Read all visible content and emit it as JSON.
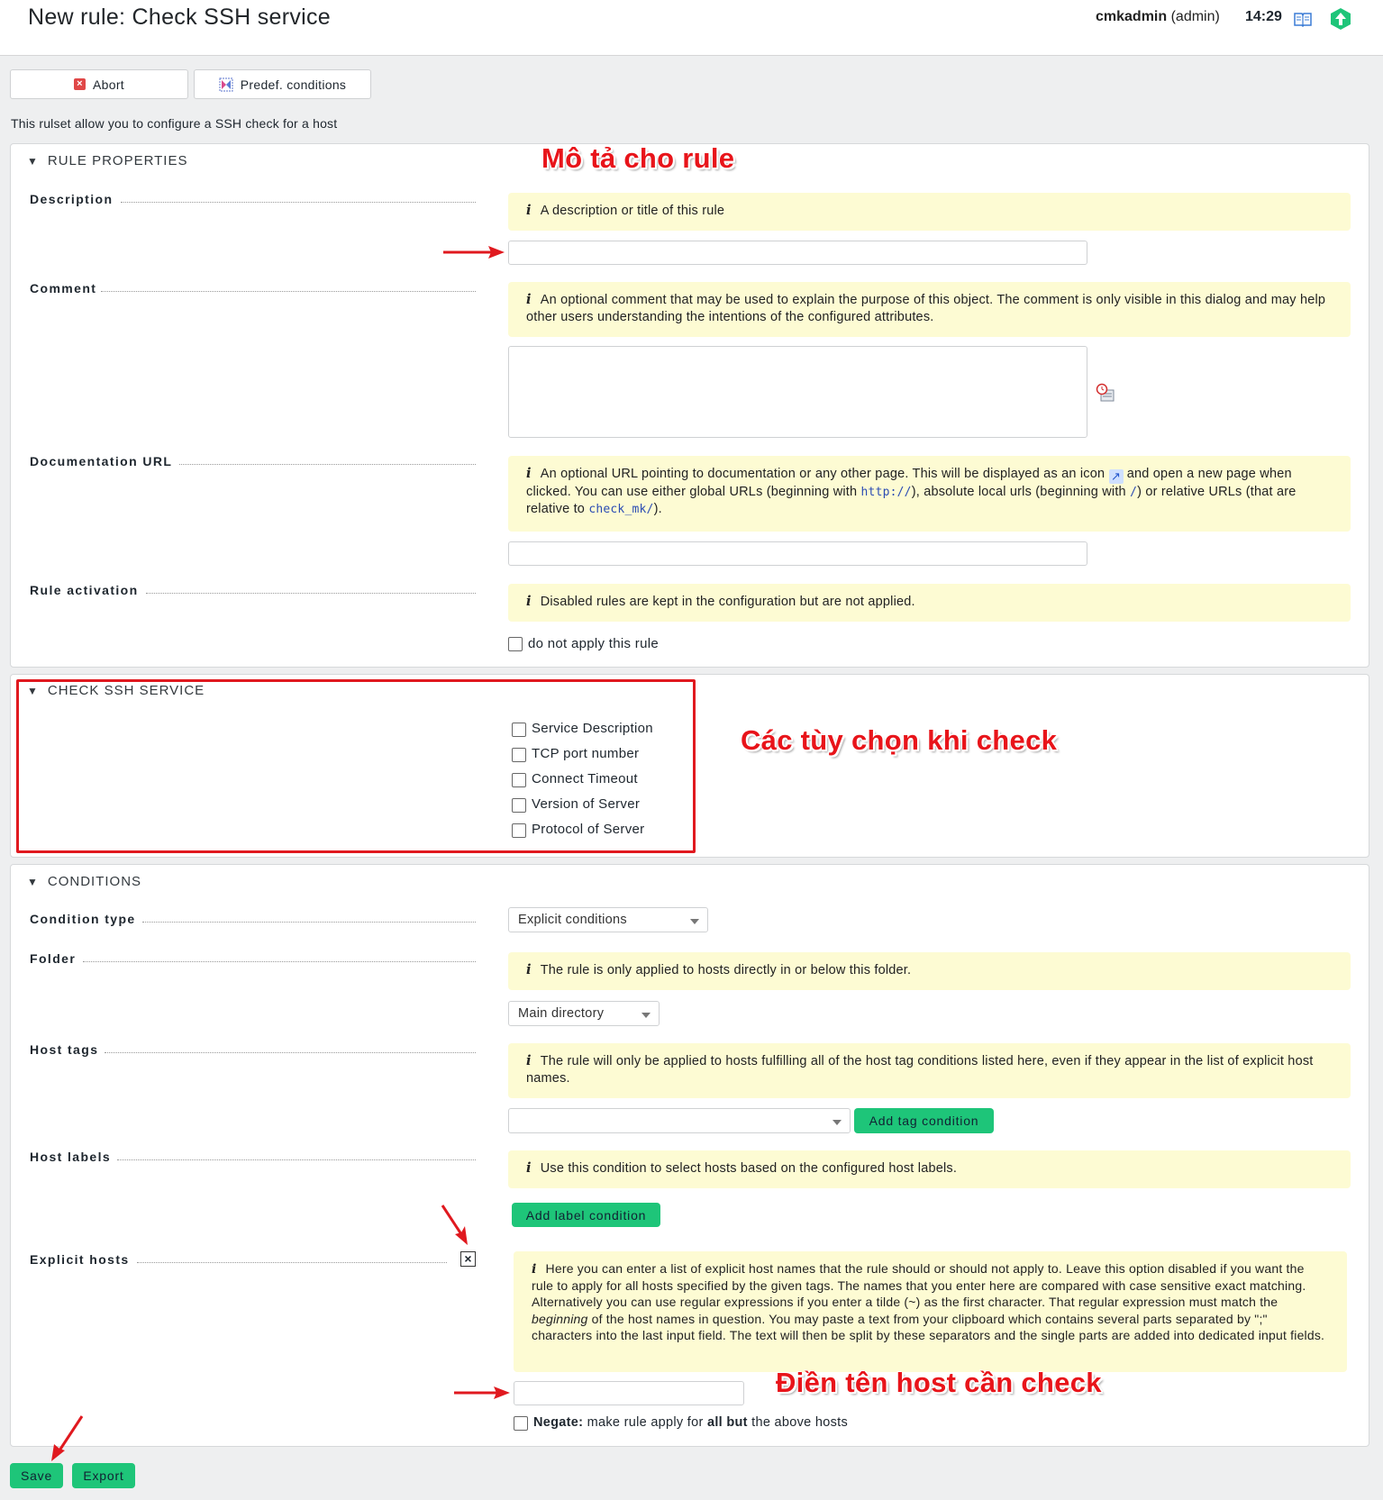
{
  "header": {
    "title": "New rule: Check SSH service",
    "user": "cmkadmin",
    "role": "(admin)",
    "time": "14:29"
  },
  "toolbar": {
    "abort_label": "Abort",
    "predef_label": "Predef. conditions"
  },
  "intro_text": "This rulset allow you to configure a SSH check for a host",
  "rule_properties": {
    "heading": "RULE PROPERTIES",
    "description": {
      "label": "Description",
      "help": "A description or title of this rule",
      "value": ""
    },
    "comment": {
      "label": "Comment",
      "help": "An optional comment that may be used to explain the purpose of this object. The comment is only visible in this dialog and may help other users understanding the intentions of the configured attributes.",
      "value": ""
    },
    "documentation_url": {
      "label": "Documentation URL",
      "help_part1": "An optional URL pointing to documentation or any other page. This will be displayed as an icon",
      "help_part2": "and open a new page when clicked. You can use either global URLs (beginning with",
      "help_code1": "http://",
      "help_part3": "), absolute local urls (beginning with",
      "help_code2": "/",
      "help_part4": ") or relative URLs (that are relative to",
      "help_code3": "check_mk/",
      "help_part5": ").",
      "value": ""
    },
    "rule_activation": {
      "label": "Rule activation",
      "help": "Disabled rules are kept in the configuration but are not applied.",
      "checkbox_label": "do not apply this rule",
      "checked": false
    }
  },
  "check_ssh": {
    "heading": "CHECK SSH SERVICE",
    "options": [
      {
        "label": "Service Description",
        "checked": false
      },
      {
        "label": "TCP port number",
        "checked": false
      },
      {
        "label": "Connect Timeout",
        "checked": false
      },
      {
        "label": "Version of Server",
        "checked": false
      },
      {
        "label": "Protocol of Server",
        "checked": false
      }
    ]
  },
  "conditions": {
    "heading": "CONDITIONS",
    "condition_type": {
      "label": "Condition type",
      "value": "Explicit conditions"
    },
    "folder": {
      "label": "Folder",
      "help": "The rule is only applied to hosts directly in or below this folder.",
      "value": "Main directory"
    },
    "host_tags": {
      "label": "Host tags",
      "help": "The rule will only be applied to hosts fulfilling all of the host tag conditions listed here, even if they appear in the list of explicit host names.",
      "value": "",
      "button": "Add tag condition"
    },
    "host_labels": {
      "label": "Host labels",
      "help": "Use this condition to select hosts based on the configured host labels.",
      "button": "Add label condition"
    },
    "explicit_hosts": {
      "label": "Explicit hosts",
      "checked": true,
      "help_a": "Here you can enter a list of explicit host names that the rule should or should not apply to. Leave this option disabled if you want the rule to apply for all hosts specified by the given tags. The names that you enter here are compared with case sensitive exact matching. Alternatively you can use regular expressions if you enter a tilde (",
      "help_tilde": "~",
      "help_b": ") as the first character. That regular expression must match the",
      "help_em": "beginning",
      "help_c": "of the host names in question. You may paste a text from your clipboard which contains several parts separated by \";\" characters into the last input field. The text will then be split by these separators and the single parts are added into dedicated input fields.",
      "value": "",
      "negate_bold1": "Negate:",
      "negate_text1": "make rule apply for",
      "negate_bold2": "all but",
      "negate_text2": "the above hosts"
    }
  },
  "footer": {
    "save_label": "Save",
    "export_label": "Export"
  },
  "annotations": {
    "rule_desc": "Mô tả cho rule",
    "check_opts": "Các tùy chọn khi check",
    "host_fill": "Điền tên host cần check"
  }
}
